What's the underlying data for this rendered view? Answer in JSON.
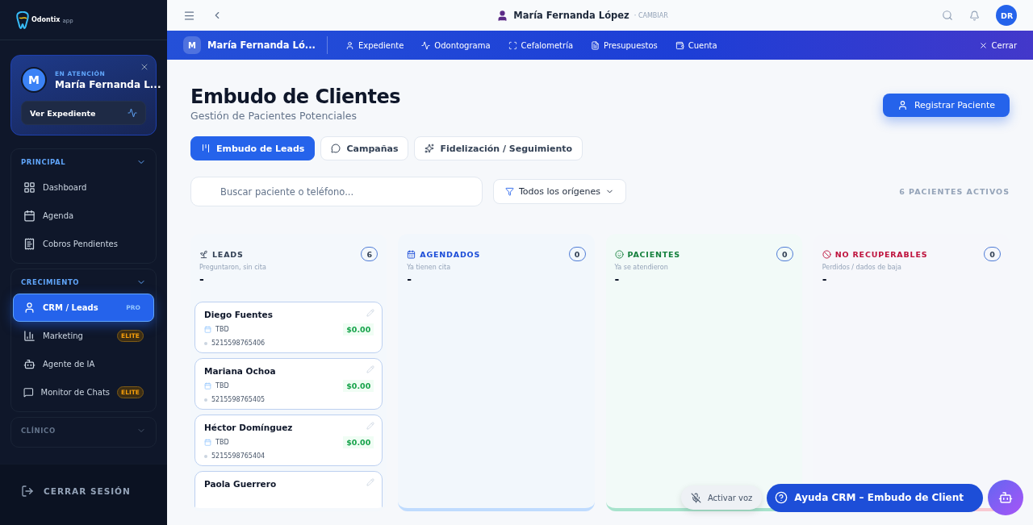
{
  "logo": {
    "name": "Odontix",
    "suffix": "app"
  },
  "attending": {
    "initial": "M",
    "label": "EN ATENCIÓN",
    "name": "María Fernanda L...",
    "button": "Ver Expediente"
  },
  "nav_sections": [
    {
      "title": "PRINCIPAL",
      "expanded": true,
      "items": [
        {
          "label": "Dashboard",
          "selected": false
        },
        {
          "label": "Agenda",
          "selected": false
        },
        {
          "label": "Cobros Pendientes",
          "selected": false
        }
      ]
    },
    {
      "title": "CRECIMIENTO",
      "expanded": true,
      "items": [
        {
          "label": "CRM / Leads",
          "selected": true,
          "badge": "PRO"
        },
        {
          "label": "Marketing",
          "selected": false,
          "badge": "ELITE"
        },
        {
          "label": "Agente de IA",
          "selected": false
        },
        {
          "label": "Monitor de Chats",
          "selected": false,
          "badge": "ELITE"
        }
      ]
    },
    {
      "title": "CLÍNICO",
      "expanded": false
    }
  ],
  "logout": "CERRAR SESIÓN",
  "topbar": {
    "patient": "María Fernanda López",
    "change": "· CAMBIAR",
    "user_initials": "DR"
  },
  "patient_bar": {
    "initial": "M",
    "name": "María Fernanda Ló...",
    "tabs": [
      "Expediente",
      "Odontograma",
      "Cefalometría",
      "Presupuestos",
      "Cuenta"
    ],
    "close": "Cerrar"
  },
  "page": {
    "title": "Embudo de Clientes",
    "subtitle": "Gestión de Pacientes Potenciales",
    "primary_button": "Registrar Paciente"
  },
  "view_tabs": [
    {
      "label": "Embudo de Leads",
      "selected": true
    },
    {
      "label": "Campañas",
      "selected": false
    },
    {
      "label": "Fidelización / Seguimiento",
      "selected": false
    }
  ],
  "search": {
    "placeholder": "Buscar paciente o teléfono..."
  },
  "filter": "Todos los orígenes",
  "active_count": "6 PACIENTES ACTIVOS",
  "columns": [
    {
      "title": "LEADS",
      "subtitle": "Preguntaron, sin cita",
      "count": "6",
      "total": "-",
      "color": "#334155",
      "cards": [
        {
          "name": "Diego Fuentes",
          "date": "TBD",
          "amount": "$0.00",
          "phone": "5215598765406"
        },
        {
          "name": "Mariana Ochoa",
          "date": "TBD",
          "amount": "$0.00",
          "phone": "5215598765405"
        },
        {
          "name": "Héctor Domínguez",
          "date": "TBD",
          "amount": "$0.00",
          "phone": "5215598765404"
        },
        {
          "name": "Paola Guerrero"
        }
      ]
    },
    {
      "title": "AGENDADOS",
      "subtitle": "Ya tienen cita",
      "count": "0",
      "total": "-",
      "color": "#1d4ed8"
    },
    {
      "title": "PACIENTES",
      "subtitle": "Ya se atendieron",
      "count": "0",
      "total": "-",
      "color": "#15803d"
    },
    {
      "title": "NO RECUPERABLES",
      "subtitle": "Perdidos / dados de baja",
      "count": "0",
      "total": "-",
      "color": "#be123c"
    }
  ],
  "help": {
    "label": "Ayuda CRM – Embudo de Client",
    "voice": "Activar voz"
  }
}
